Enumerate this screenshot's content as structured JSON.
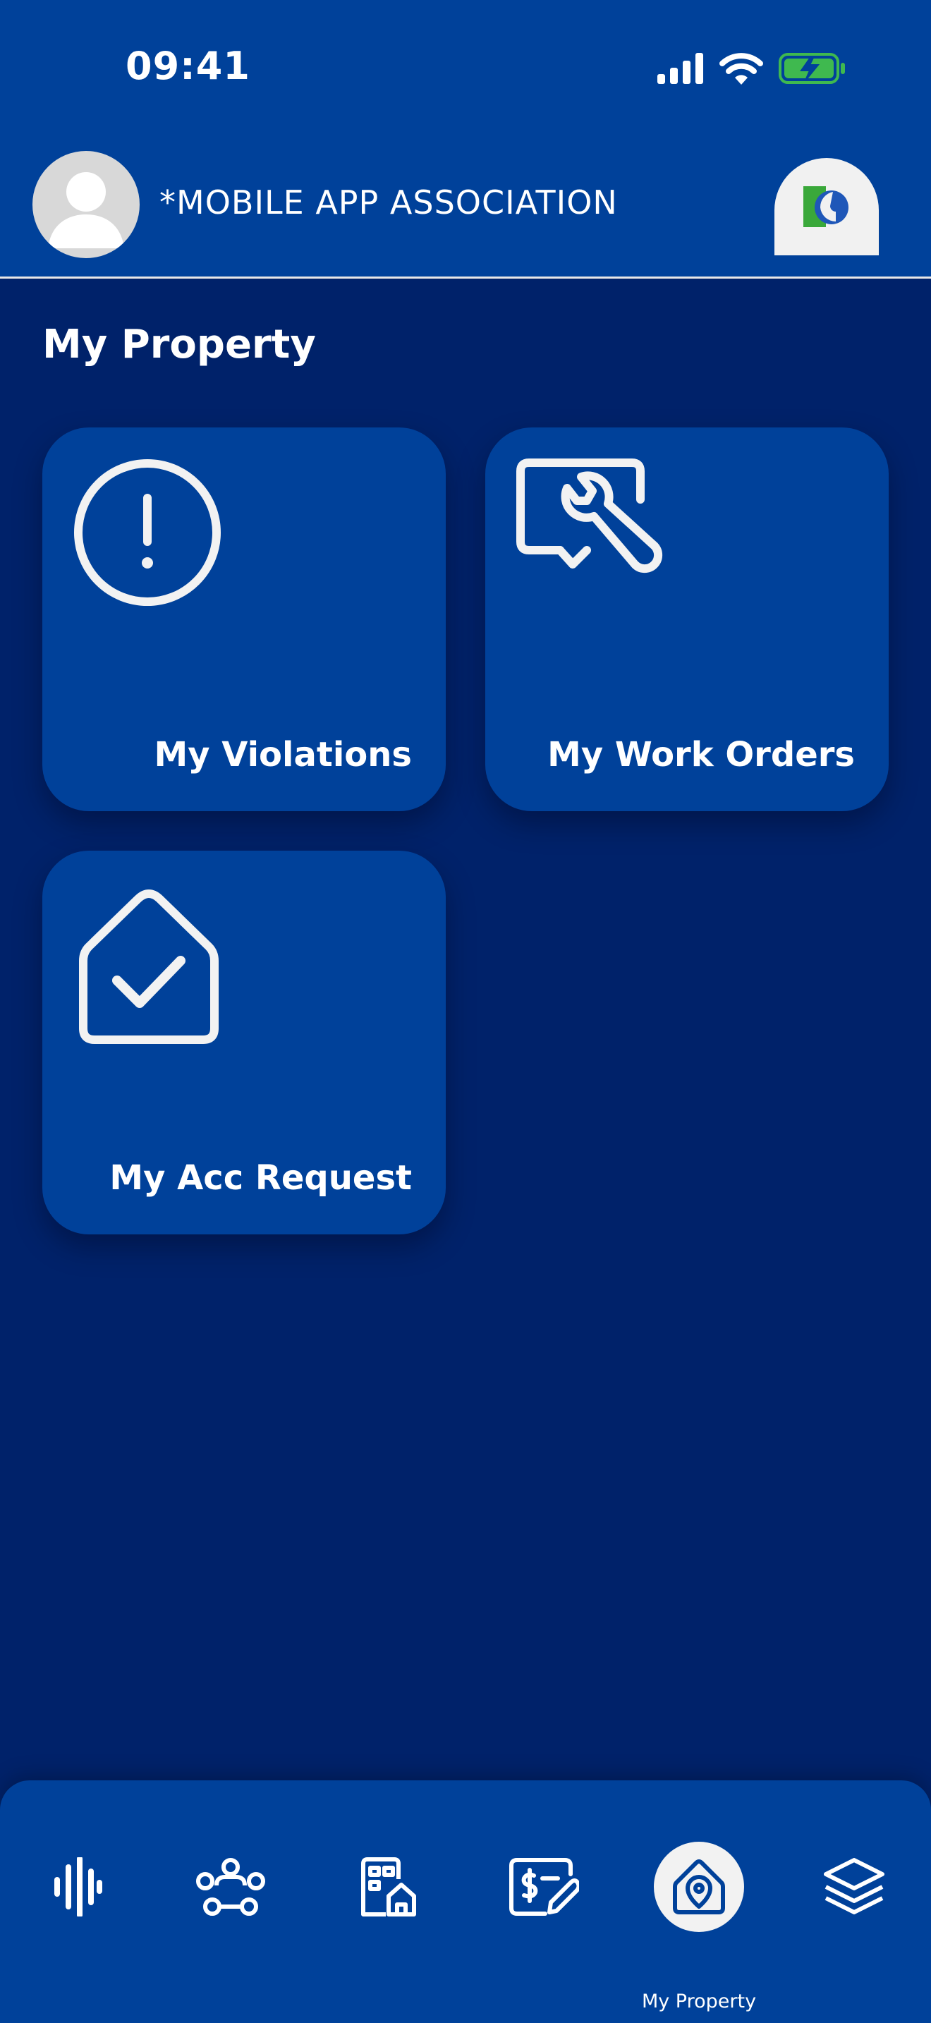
{
  "status": {
    "time": "09:41"
  },
  "header": {
    "association_name": "*MOBILE APP ASSOCIATION"
  },
  "page": {
    "title": "My Property"
  },
  "cards": [
    {
      "label": "My Violations",
      "icon": "alert-circle-icon"
    },
    {
      "label": "My Work Orders",
      "icon": "wrench-chat-icon"
    },
    {
      "label": "My Acc Request",
      "icon": "home-check-icon"
    }
  ],
  "nav": {
    "items": [
      {
        "icon": "audio-wave-icon"
      },
      {
        "icon": "community-people-icon"
      },
      {
        "icon": "building-home-icon"
      },
      {
        "icon": "payment-edit-icon"
      },
      {
        "icon": "property-location-icon",
        "label": "My Property",
        "active": true
      },
      {
        "icon": "layers-icon"
      }
    ]
  },
  "colors": {
    "background": "#00226a",
    "header": "#00419a",
    "card": "#00419a",
    "battery_fill": "#3fb94f",
    "logo_green": "#3aa83a",
    "logo_blue": "#1f57b8"
  }
}
